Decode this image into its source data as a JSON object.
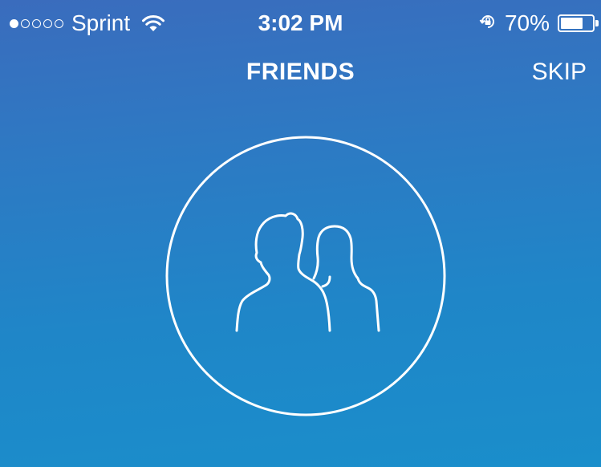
{
  "status_bar": {
    "signal_strength": 1,
    "signal_max": 5,
    "carrier": "Sprint",
    "time": "3:02 PM",
    "battery_percent": "70%",
    "battery_level": 0.7,
    "icons": [
      "wifi-icon",
      "rotation-lock-icon",
      "battery-icon"
    ]
  },
  "nav": {
    "title": "FRIENDS",
    "skip_label": "SKIP"
  },
  "hero": {
    "icon": "friends-icon"
  },
  "colors": {
    "gradient_top": "#3a6cbd",
    "gradient_bottom": "#1a8ecb",
    "foreground": "#ffffff"
  }
}
